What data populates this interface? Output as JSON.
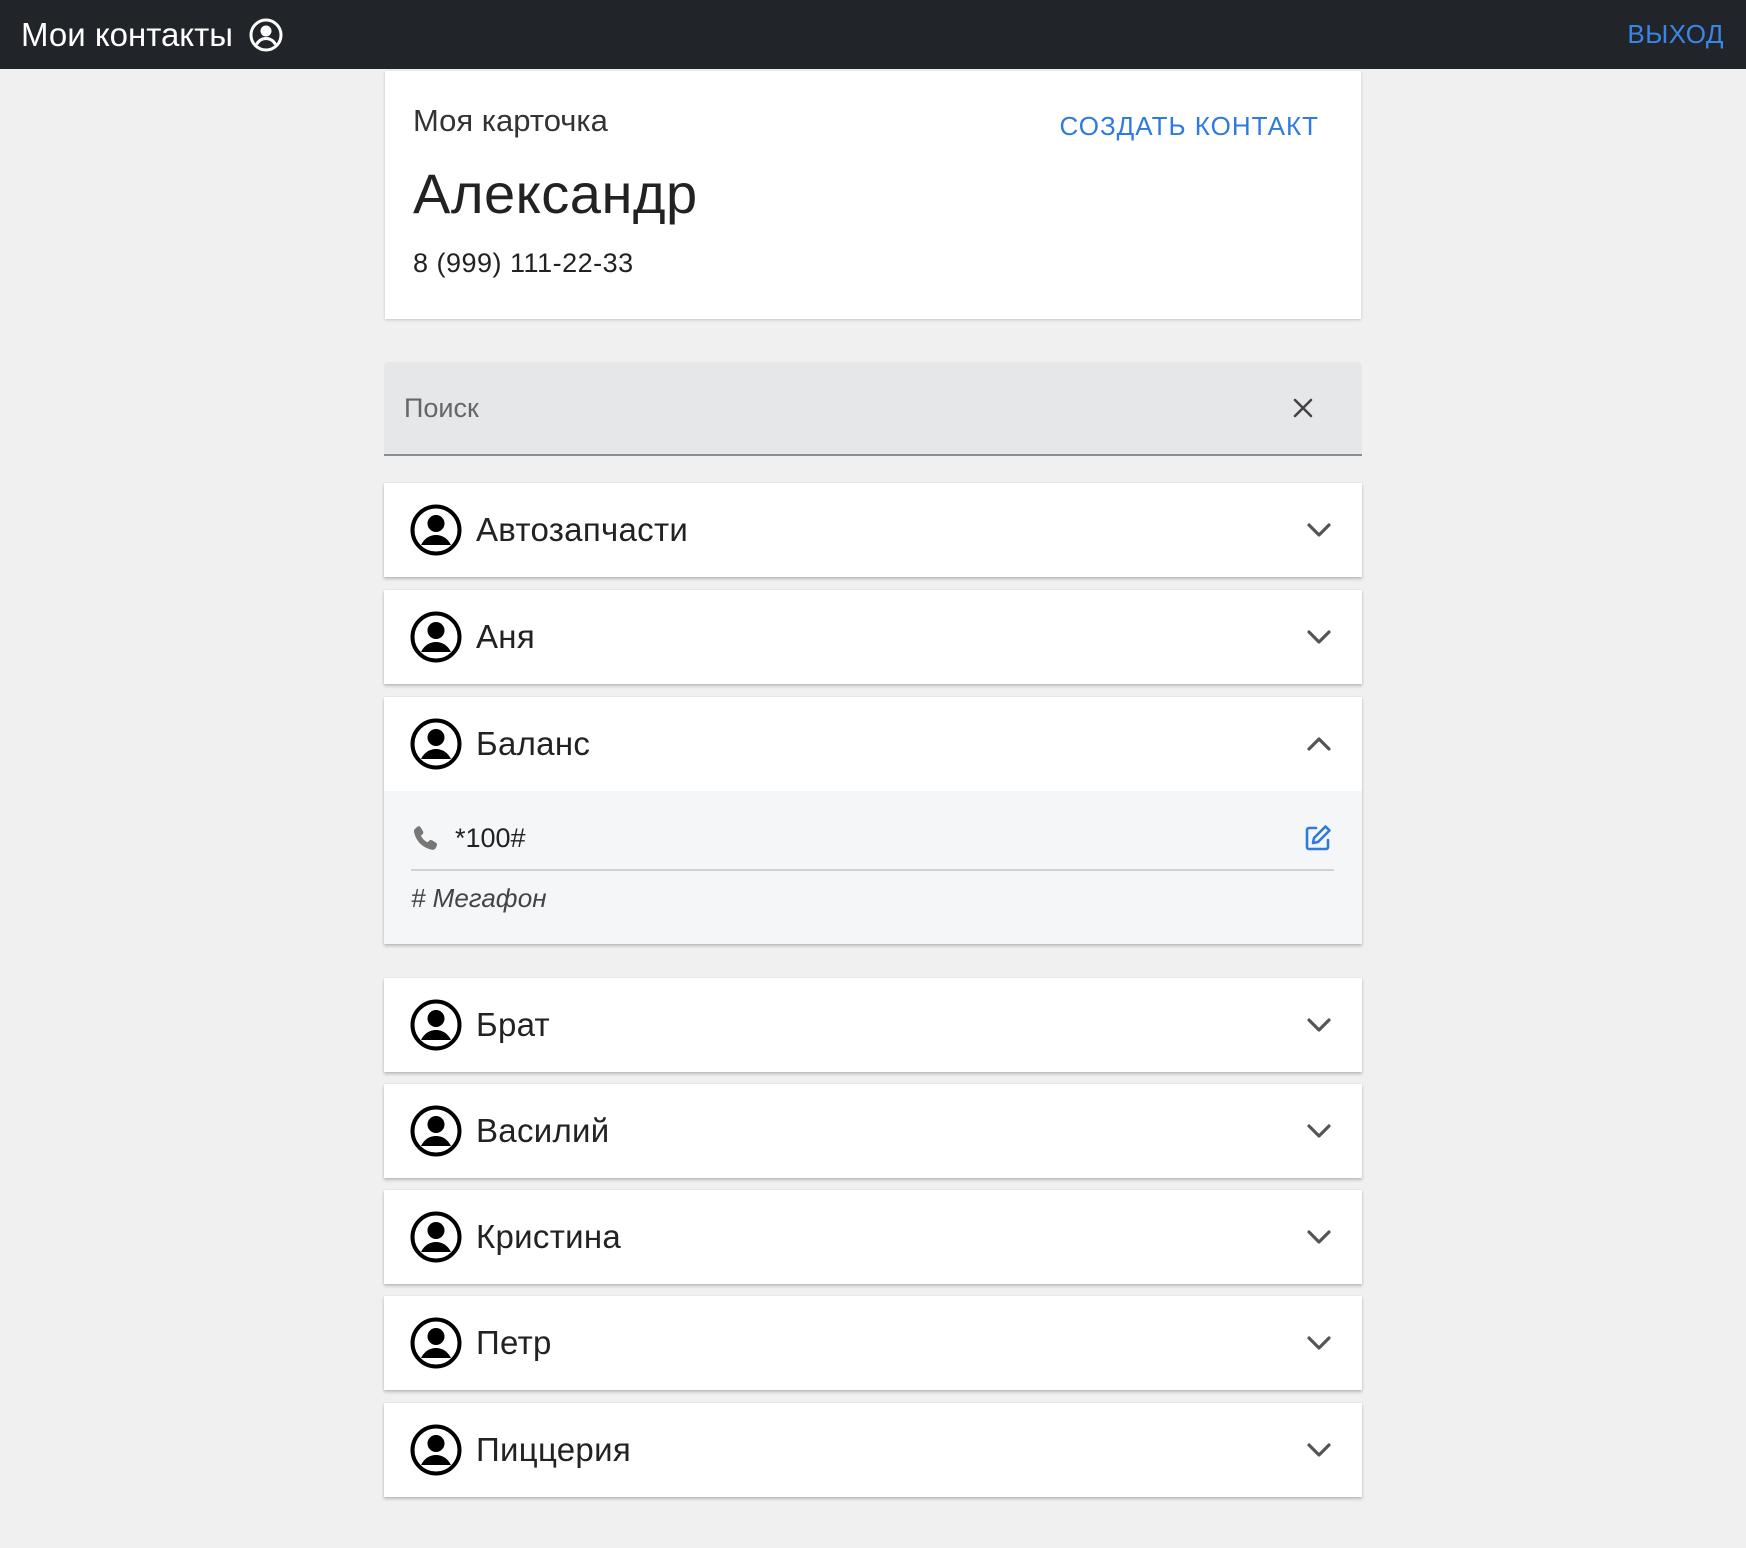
{
  "header": {
    "title": "Мои контакты",
    "logout_label": "выход"
  },
  "my_card": {
    "caption": "Моя карточка",
    "name": "Александр",
    "phone": "8 (999) 111-22-33",
    "create_label": "создать контакт"
  },
  "search": {
    "placeholder": "Поиск",
    "value": ""
  },
  "contacts": [
    {
      "name": "Автозапчасти",
      "expanded": false
    },
    {
      "name": "Аня",
      "expanded": false
    },
    {
      "name": "Баланс",
      "expanded": true,
      "phone": "*100#",
      "note": "# Мегафон"
    },
    {
      "name": "Брат",
      "expanded": false
    },
    {
      "name": "Василий",
      "expanded": false
    },
    {
      "name": "Кристина",
      "expanded": false
    },
    {
      "name": "Петр",
      "expanded": false
    },
    {
      "name": "Пиццерия",
      "expanded": false
    }
  ],
  "colors": {
    "topbar": "#212529",
    "accent": "#2f7ae0",
    "background": "#f0f0f0"
  },
  "icons": {
    "user": "user-circle-icon",
    "expand": "chevron-down-icon",
    "collapse": "chevron-up-icon",
    "phone": "phone-icon",
    "edit": "edit-icon",
    "clear": "close-icon"
  }
}
